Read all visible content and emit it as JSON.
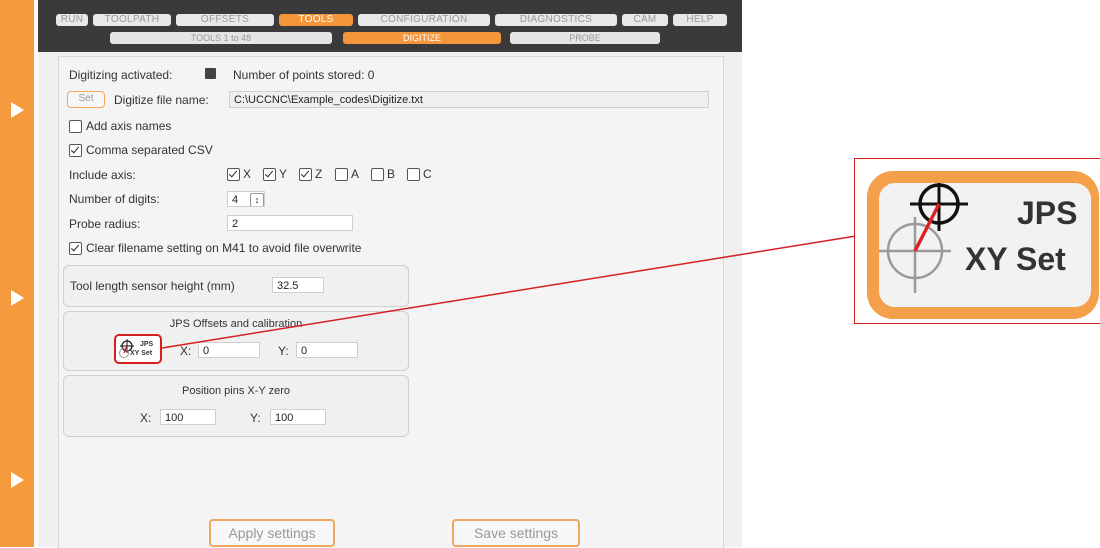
{
  "tabs": [
    {
      "label": "RUN",
      "active": false
    },
    {
      "label": "TOOLPATH",
      "active": false
    },
    {
      "label": "OFFSETS",
      "active": false
    },
    {
      "label": "TOOLS",
      "active": true
    },
    {
      "label": "CONFIGURATION",
      "active": false
    },
    {
      "label": "DIAGNOSTICS",
      "active": false
    },
    {
      "label": "CAM",
      "active": false
    },
    {
      "label": "HELP",
      "active": false
    }
  ],
  "subtabs": [
    {
      "label": "TOOLS 1 to 48",
      "active": false
    },
    {
      "label": "DIGITIZE",
      "active": true
    },
    {
      "label": "PROBE",
      "active": false
    }
  ],
  "digitize": {
    "activated_label": "Digitizing activated:",
    "points_label": "Number of points stored:",
    "points_value": "0",
    "set_label": "Set",
    "file_label": "Digitize file name:",
    "file_value": "C:\\UCCNC\\Example_codes\\Digitize.txt",
    "add_axis_names": "Add axis names",
    "comma_csv": "Comma separated CSV",
    "include_axis_label": "Include axis:",
    "axes": [
      {
        "name": "X",
        "checked": true
      },
      {
        "name": "Y",
        "checked": true
      },
      {
        "name": "Z",
        "checked": true
      },
      {
        "name": "A",
        "checked": false
      },
      {
        "name": "B",
        "checked": false
      },
      {
        "name": "C",
        "checked": false
      }
    ],
    "digits_label": "Number of digits:",
    "digits_value": "4",
    "spinner_glyph": "↕",
    "probe_radius_label": "Probe radius:",
    "probe_radius_value": "2",
    "clear_filename": "Clear filename setting on M41 to avoid file overwrite"
  },
  "tool_length": {
    "label": "Tool length sensor height (mm)",
    "value": "32.5"
  },
  "jps": {
    "title": "JPS Offsets and calibration",
    "button_line1": "JPS",
    "button_line2": "XY Set",
    "x_label": "X:",
    "x_value": "0",
    "y_label": "Y:",
    "y_value": "0"
  },
  "position_pins": {
    "title": "Position pins X-Y zero",
    "x_label": "X:",
    "x_value": "100",
    "y_label": "Y:",
    "y_value": "100"
  },
  "buttons": {
    "apply": "Apply settings",
    "save": "Save settings"
  },
  "zoom": {
    "line1": "JPS",
    "line2": "XY Set"
  },
  "colors": {
    "accent": "#f5963a",
    "callout": "#d42020"
  }
}
